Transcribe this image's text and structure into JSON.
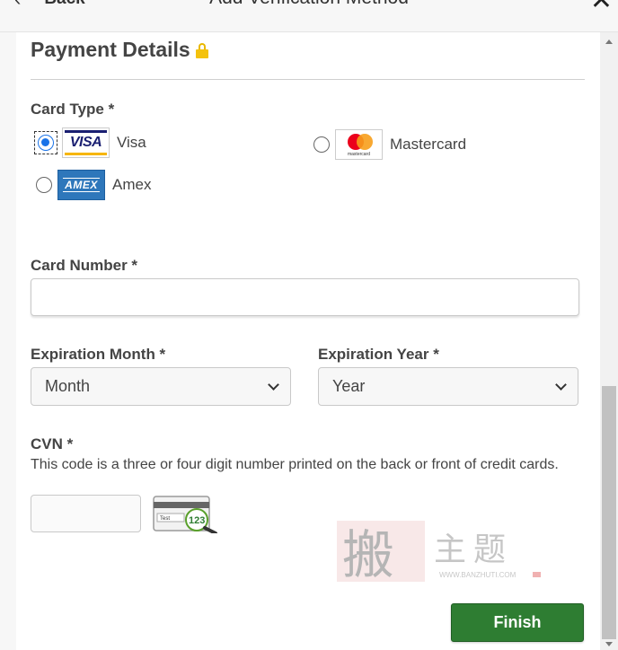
{
  "header": {
    "back_label": "Back",
    "title": "Add Verification Method",
    "close_label": "✕"
  },
  "section": {
    "title": "Payment Details"
  },
  "card_type": {
    "label": "Card Type *",
    "selected": "Visa",
    "options": [
      {
        "label": "Visa",
        "logo": "VISA",
        "checked": true
      },
      {
        "label": "Mastercard",
        "logo": "mastercard",
        "checked": false
      },
      {
        "label": "Amex",
        "logo": "AMEX",
        "checked": false
      }
    ]
  },
  "card_number": {
    "label": "Card Number *",
    "value": ""
  },
  "expiration_month": {
    "label": "Expiration Month *",
    "selected": "Month"
  },
  "expiration_year": {
    "label": "Expiration Year *",
    "selected": "Year"
  },
  "cvn": {
    "label": "CVN *",
    "help": "This code is a three or four digit number printed on the back or front of credit cards.",
    "value": "",
    "illustration_text": "123",
    "illustration_caption": "Test"
  },
  "watermark": {
    "glyphs": "搬主题",
    "url": "WWW.BANZHUTI.COM"
  },
  "actions": {
    "finish_label": "Finish"
  },
  "colors": {
    "primary_button": "#2e7d32",
    "radio_selected": "#1a73e8",
    "lock": "#f4c20d"
  }
}
